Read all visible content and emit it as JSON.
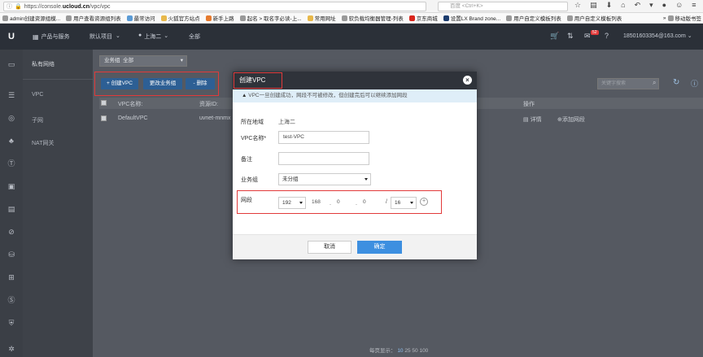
{
  "browser": {
    "url_prefix": "https://console.",
    "url_domain": "ucloud.cn",
    "url_path": "/vpc/vpc",
    "search_placeholder": "百度 <Ctrl+K>",
    "bookmarks": [
      "admin创建资源组模...",
      "用户查看资源组列表",
      "最常访问",
      "火狐官方站点",
      "新手上路",
      "起名 > 取名字必读-上...",
      "常用网址",
      "软负载均衡器管理-列表",
      "京东商城",
      "设置LX Brand zone...",
      "用户自定义模板列表",
      "用户自定义模板列表",
      "移动版书签"
    ]
  },
  "topnav": {
    "logo": "U",
    "products": "产品与服务",
    "project": "默认项目",
    "region": "上海二",
    "all": "全部",
    "badge": "52",
    "account": "18501603354@163.com"
  },
  "sidebar": {
    "title": "私有网络",
    "items": [
      "VPC",
      "子网",
      "NAT网关"
    ]
  },
  "content": {
    "group_label": "业务组",
    "group_value": "全部",
    "btn_create": "+ 创建VPC",
    "btn_change_group": "更改业务组",
    "btn_delete": "- 删除",
    "search_placeholder": "关键字搜索",
    "col_name": "VPC名称:",
    "col_id": "资源ID:",
    "col_ops": "操作",
    "row_name": "DefaultVPC",
    "row_id": "uvnet-mnmx",
    "row_op_detail": "详情",
    "row_op_add": "添加网段",
    "pagination_label": "每页显示：",
    "pagination_opts": [
      "10",
      "25",
      "50",
      "100"
    ]
  },
  "modal": {
    "title": "创建VPC",
    "warning": "VPC一旦创建成功，网段不可被修改，但创建完后可以继续添加网段",
    "region_label": "所在地域",
    "region_value": "上海二",
    "name_label": "VPC名称*",
    "name_value": "test-VPC",
    "remark_label": "备注",
    "remark_value": "",
    "group_label": "业务组",
    "group_value": "未分组",
    "cidr_label": "网段",
    "cidr_a": "192",
    "cidr_b": "168",
    "cidr_c": "0",
    "cidr_d": "0",
    "cidr_mask": "16",
    "cancel": "取消",
    "confirm": "确定"
  },
  "colors": {
    "accent_blue": "#3d8fe0",
    "highlight_red": "#e23a3a",
    "dark_header": "#2f333a"
  }
}
